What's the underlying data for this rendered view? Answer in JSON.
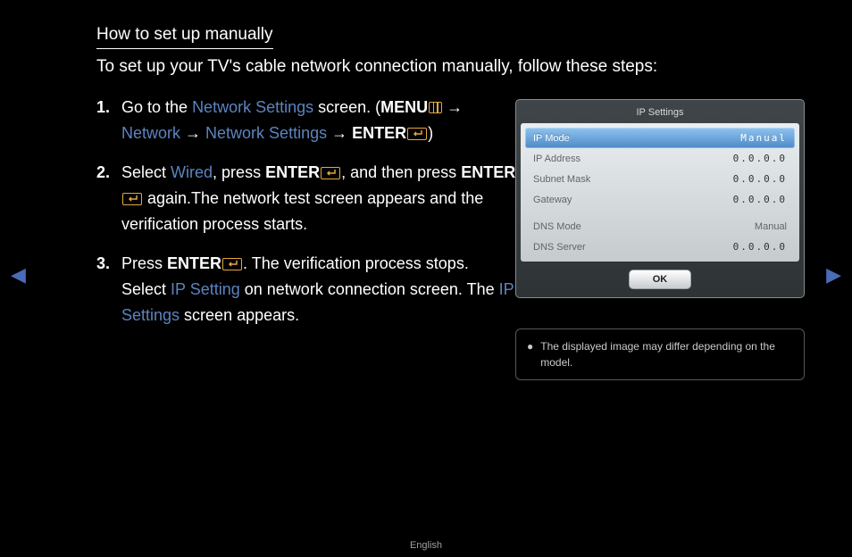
{
  "title": "How to set up manually",
  "intro": "To set up your TV's cable network connection manually, follow these steps:",
  "steps": {
    "s1": {
      "num": "1.",
      "t1": "Go to the ",
      "networkSettings": "Network Settings",
      "t2": " screen. (",
      "menu": "MENU",
      "arrow": " → ",
      "network": "Network",
      "enter": "ENTER",
      "close": ")"
    },
    "s2": {
      "num": "2.",
      "t1": "Select ",
      "wired": "Wired",
      "t2": ", press ",
      "enter": "ENTER",
      "t3": ", and then press ",
      "t4": " again.The network test screen appears and the verification process starts."
    },
    "s3": {
      "num": "3.",
      "t1": "Press ",
      "enter": "ENTER",
      "t2": ". The verification process stops. Select ",
      "ipSetting": "IP Setting",
      "t3": " on network connection screen. The ",
      "ipSettings": "IP Settings",
      "t4": " screen appears."
    }
  },
  "panel": {
    "title": "IP Settings",
    "rows": {
      "ipMode": {
        "label": "IP Mode",
        "value": "Manual"
      },
      "ipAddress": {
        "label": "IP Address",
        "value": "0.0.0.0"
      },
      "subnet": {
        "label": "Subnet Mask",
        "value": "0.0.0.0"
      },
      "gateway": {
        "label": "Gateway",
        "value": "0.0.0.0"
      },
      "dnsMode": {
        "label": "DNS Mode",
        "value": "Manual"
      },
      "dnsServer": {
        "label": "DNS Server",
        "value": "0.0.0.0"
      }
    },
    "ok": "OK",
    "note": "The displayed image may differ depending on the model."
  },
  "footer": "English",
  "nav": {
    "left": "◀",
    "right": "▶"
  },
  "bullet": "●"
}
